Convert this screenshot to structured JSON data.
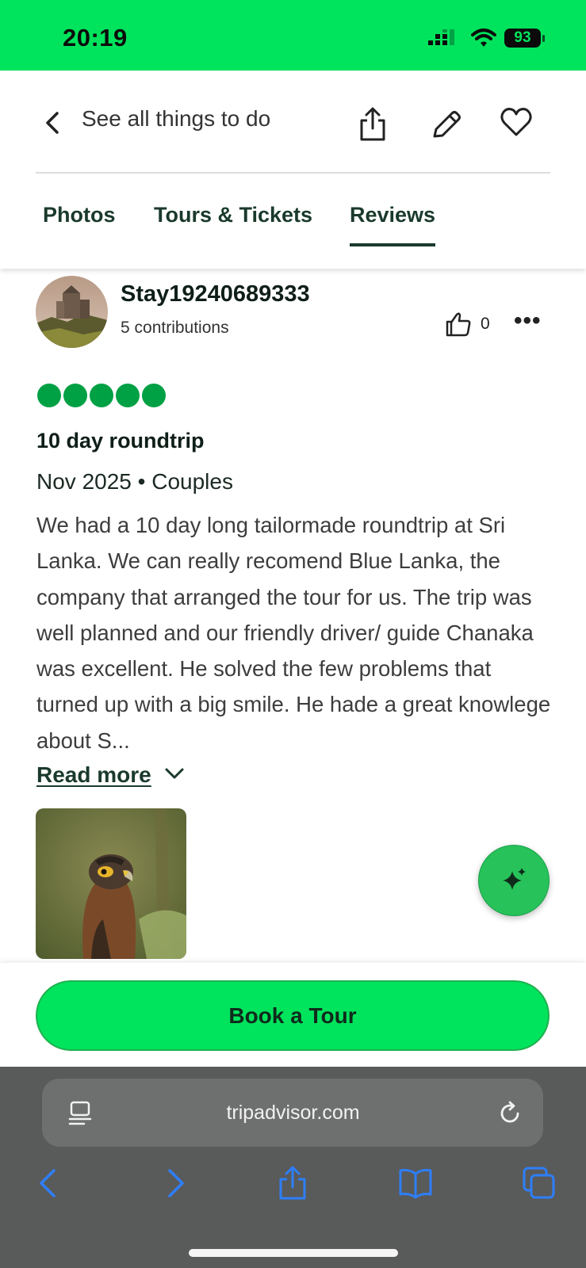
{
  "status_bar": {
    "time": "20:19",
    "battery": "93"
  },
  "header": {
    "back_label": "See all things to do",
    "tabs": [
      {
        "label": "Photos"
      },
      {
        "label": "Tours & Tickets"
      },
      {
        "label": "Reviews",
        "active": true
      }
    ],
    "icons": [
      "chevron-left-icon",
      "share-icon",
      "pencil-icon",
      "heart-icon"
    ]
  },
  "review": {
    "username": "Stay19240689333",
    "contributions": "5 contributions",
    "helpful_count": "0",
    "rating": 5,
    "rating_max": 5,
    "title": "10 day roundtrip",
    "meta": "Nov 2025 • Couples",
    "body": "We had a 10 day long tailormade roundtrip at Sri Lanka. We can really recomend Blue Lanka, the company that arranged the tour for us. The trip was well planned and our friendly driver/ guide Chanaka was excellent. He solved the few problems that turned up with a big smile. He hade a great knowlege about S...",
    "read_more": "Read more"
  },
  "cta": {
    "book_label": "Book a Tour"
  },
  "browser": {
    "url": "tripadvisor.com"
  },
  "colors": {
    "brand_green": "#00e45d",
    "rating_green": "#00a044",
    "dark_green": "#1a3a2c"
  }
}
